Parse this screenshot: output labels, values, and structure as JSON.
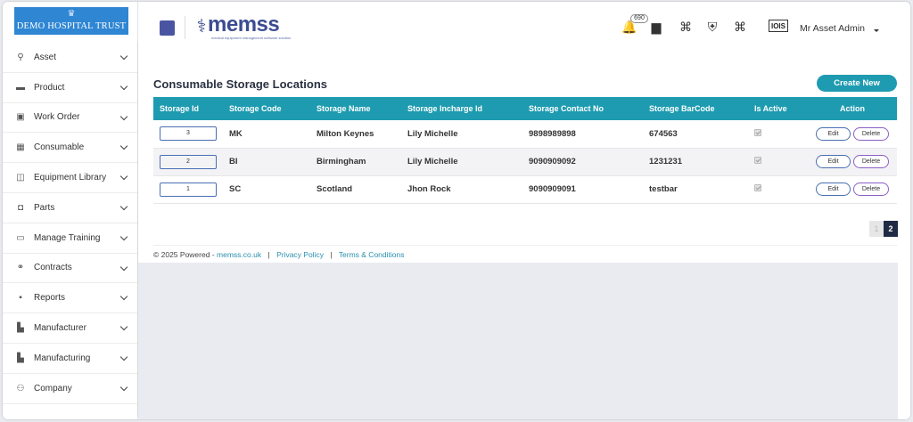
{
  "sidebar": {
    "hospital_name": "DEMO HOSPITAL TRUST",
    "items": [
      {
        "label": "Asset",
        "icon": "asset-icon"
      },
      {
        "label": "Product",
        "icon": "product-icon"
      },
      {
        "label": "Work Order",
        "icon": "work-order-icon"
      },
      {
        "label": "Consumable",
        "icon": "consumable-icon"
      },
      {
        "label": "Equipment Library",
        "icon": "equipment-library-icon"
      },
      {
        "label": "Parts",
        "icon": "parts-icon"
      },
      {
        "label": "Manage Training",
        "icon": "training-icon"
      },
      {
        "label": "Contracts",
        "icon": "contracts-icon"
      },
      {
        "label": "Reports",
        "icon": "reports-icon"
      },
      {
        "label": "Manufacturer",
        "icon": "manufacturer-icon"
      },
      {
        "label": "Manufacturing",
        "icon": "manufacturing-icon"
      },
      {
        "label": "Company",
        "icon": "company-icon"
      }
    ]
  },
  "header": {
    "brand": "memss",
    "brand_tagline": "medical equipment management software solution",
    "notification_count": "690",
    "user_name": "Mr Asset Admin",
    "user_avatar_text": "IOIS"
  },
  "main": {
    "title": "Consumable Storage Locations",
    "create_label": "Create New",
    "columns": [
      "Storage Id",
      "Storage Code",
      "Storage Name",
      "Storage Incharge Id",
      "Storage Contact No",
      "Storage BarCode",
      "Is Active",
      "Action"
    ],
    "rows": [
      {
        "id": "3",
        "code": "MK",
        "name": "Milton Keynes",
        "incharge": "Lily Michelle",
        "contact": "9898989898",
        "barcode": "674563",
        "active": true
      },
      {
        "id": "2",
        "code": "BI",
        "name": "Birmingham",
        "incharge": "Lily Michelle",
        "contact": "9090909092",
        "barcode": "1231231",
        "active": true
      },
      {
        "id": "1",
        "code": "SC",
        "name": "Scotland",
        "incharge": "Jhon Rock",
        "contact": "9090909091",
        "barcode": "testbar",
        "active": true
      }
    ],
    "edit_label": "Edit",
    "delete_label": "Delete",
    "pagination": {
      "pages": [
        "1",
        "2"
      ],
      "current": "2"
    }
  },
  "footer": {
    "copyright": "© 2025 Powered -",
    "powered_link": "memss.co.uk",
    "privacy": "Privacy Policy",
    "terms": "Terms & Conditions",
    "separator": "|"
  },
  "colors": {
    "accent": "#1e9bb0",
    "brand": "#3c4c91",
    "logo_bg": "#2f86d3",
    "pager_active": "#1f2a44"
  }
}
